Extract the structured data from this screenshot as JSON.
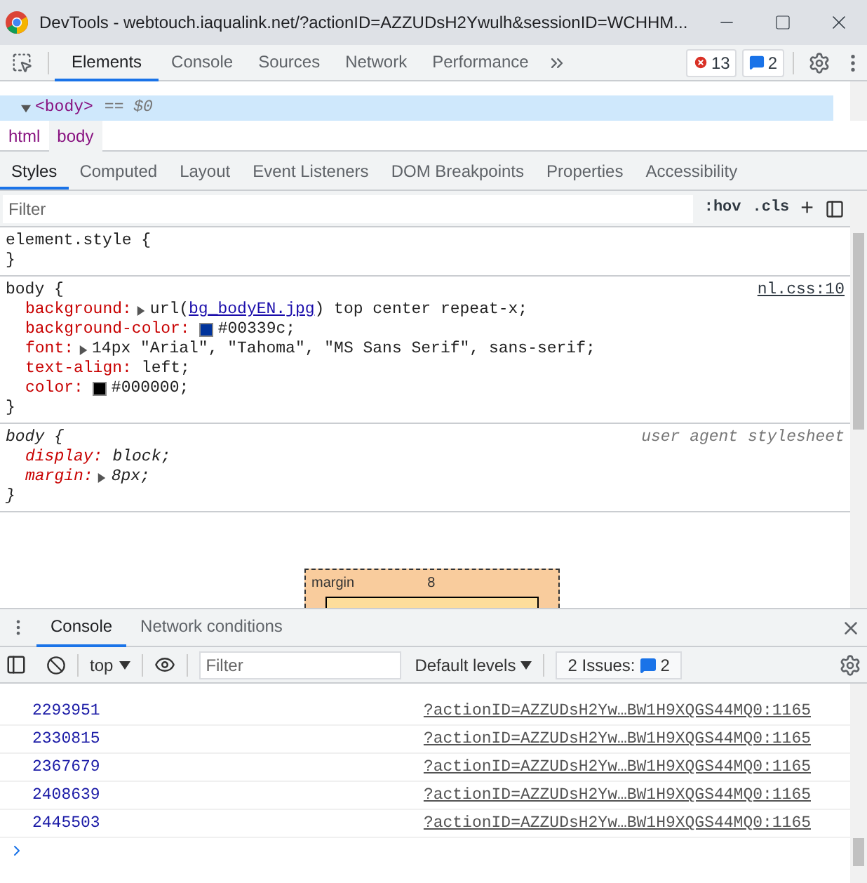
{
  "window": {
    "title": "DevTools - webtouch.iaqualink.net/?actionID=AZZUDsH2Ywulh&sessionID=WCHHM..."
  },
  "toolbar": {
    "tabs": [
      {
        "label": "Elements",
        "selected": true
      },
      {
        "label": "Console",
        "selected": false
      },
      {
        "label": "Sources",
        "selected": false
      },
      {
        "label": "Network",
        "selected": false
      },
      {
        "label": "Performance",
        "selected": false
      }
    ],
    "errors": "13",
    "messages": "2"
  },
  "dom_tree": [
    {
      "tag": "<body>",
      "note": "== $0",
      "selected": true,
      "expanded": true
    }
  ],
  "breadcrumbs": [
    {
      "label": "html",
      "selected": false
    },
    {
      "label": "body",
      "selected": true
    }
  ],
  "styles_tabs": [
    {
      "label": "Styles",
      "selected": true
    },
    {
      "label": "Computed",
      "selected": false
    },
    {
      "label": "Layout",
      "selected": false
    },
    {
      "label": "Event Listeners",
      "selected": false
    },
    {
      "label": "DOM Breakpoints",
      "selected": false
    },
    {
      "label": "Properties",
      "selected": false
    },
    {
      "label": "Accessibility",
      "selected": false
    }
  ],
  "styles_filter": {
    "placeholder": "Filter",
    "hov": ":hov",
    "cls": ".cls",
    "add": "+"
  },
  "rules": [
    {
      "selector": "element.style {",
      "close": "}",
      "user_agent": false
    },
    {
      "selector": "body {",
      "close": "}",
      "source": "nl.css:10",
      "user_agent": false,
      "declarations": [
        {
          "property": "background:",
          "expandable": true,
          "value": [
            {
              "kind": "text",
              "text": "url("
            },
            {
              "kind": "link",
              "text": "bg_bodyEN.jpg"
            },
            {
              "kind": "text",
              "text": ") top center repeat-x;"
            }
          ]
        },
        {
          "property": "background-color:",
          "expandable": false,
          "value": [
            {
              "kind": "swatch",
              "color": "#00339c"
            },
            {
              "kind": "text",
              "text": "#00339c;"
            }
          ]
        },
        {
          "property": "font:",
          "expandable": true,
          "value": [
            {
              "kind": "text",
              "text": "14px \"Arial\", \"Tahoma\", \"MS Sans Serif\", sans-serif;"
            }
          ]
        },
        {
          "property": "text-align:",
          "expandable": false,
          "value": [
            {
              "kind": "text",
              "text": "left;"
            }
          ]
        },
        {
          "property": "color:",
          "expandable": false,
          "value": [
            {
              "kind": "swatch",
              "color": "#000000"
            },
            {
              "kind": "text",
              "text": "#000000;"
            }
          ]
        }
      ]
    },
    {
      "selector": "body {",
      "close": "}",
      "source": "user agent stylesheet",
      "user_agent": true,
      "declarations": [
        {
          "property": "display:",
          "expandable": false,
          "value": [
            {
              "kind": "text",
              "text": "block;"
            }
          ]
        },
        {
          "property": "margin:",
          "expandable": true,
          "value": [
            {
              "kind": "text",
              "text": "8px;"
            }
          ]
        }
      ]
    }
  ],
  "box_model": {
    "label": "margin",
    "value": "8"
  },
  "drawer": {
    "tabs": [
      {
        "label": "Console",
        "selected": true
      },
      {
        "label": "Network conditions",
        "selected": false
      }
    ],
    "context": "top",
    "filter": {
      "placeholder": "Filter"
    },
    "levels": "Default levels",
    "issues": "2 Issues:",
    "issues_count": "2",
    "rows": [
      {
        "value": "2293951",
        "source": "?actionID=AZZUDsH2Yw…BW1H9XQGS44MQ0:1165"
      },
      {
        "value": "2330815",
        "source": "?actionID=AZZUDsH2Yw…BW1H9XQGS44MQ0:1165"
      },
      {
        "value": "2367679",
        "source": "?actionID=AZZUDsH2Yw…BW1H9XQGS44MQ0:1165"
      },
      {
        "value": "2408639",
        "source": "?actionID=AZZUDsH2Yw…BW1H9XQGS44MQ0:1165"
      },
      {
        "value": "2445503",
        "source": "?actionID=AZZUDsH2Yw…BW1H9XQGS44MQ0:1165"
      }
    ]
  }
}
